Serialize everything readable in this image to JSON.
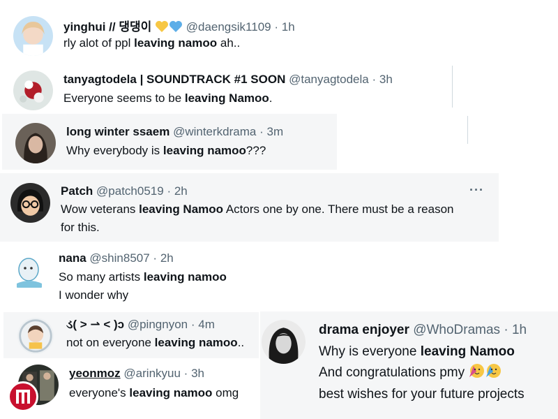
{
  "tweets": [
    {
      "name": "yinghui // 댕댕이",
      "name_emojis": [
        "yellow-heart-icon",
        "blue-heart-icon"
      ],
      "handle": "@daengsik1109",
      "time": "1h",
      "text_pre": "rly alot of ppl ",
      "text_bold": "leaving namoo",
      "text_post": " ah..",
      "colors": {
        "hair": "#e8c79a",
        "skin": "#f3d9c6",
        "bg": "#c7e2f5"
      }
    },
    {
      "name": "tanyagtodela | SOUNDTRACK #1 SOON",
      "handle": "@tanyagtodela",
      "time": "3h",
      "text_pre": "Everyone seems to be ",
      "text_bold": "leaving Namoo",
      "text_post": ".",
      "colors": {
        "flower": "#b21e2a",
        "bg": "#dfe6e4"
      }
    },
    {
      "name": "long winter ssaem",
      "handle": "@winterkdrama",
      "time": "3m",
      "text_pre": "Why everybody is ",
      "text_bold": "leaving namoo",
      "text_post": "???",
      "colors": {
        "hair": "#2a221d",
        "skin": "#d9b8a3",
        "bg": "#6a6158"
      }
    },
    {
      "name": "Patch",
      "handle": "@patch0519",
      "time": "2h",
      "text_pre": "Wow veterans ",
      "text_bold": "leaving Namoo",
      "text_post": " Actors one by one. There must be a reason",
      "text_line2": "for this.",
      "more": "···",
      "colors": {
        "hair": "#111111",
        "skin": "#f0c9a6",
        "bg": "#2b2b2b"
      }
    },
    {
      "name": "nana",
      "handle": "@shin8507",
      "time": "2h",
      "text_pre": "So many artists ",
      "text_bold": "leaving namoo",
      "text_post": "",
      "text_line2": "I wonder why",
      "colors": {
        "body": "#e8f1f6",
        "outline": "#5aa7c8",
        "bg": "#ffffff"
      }
    },
    {
      "name": "ડ( > ⇀ < )ɔ",
      "handle": "@pingnyon",
      "time": "4m",
      "text_pre": "not on everyone ",
      "text_bold": "leaving namoo",
      "text_post": "..",
      "colors": {
        "ring": "#b9c6cf",
        "skin": "#f2d4bd",
        "bg": "#eef1f3"
      }
    },
    {
      "name": "yeonmoz",
      "handle": "@arinkyuu",
      "time": "3h",
      "text_pre": "everyone's ",
      "text_bold": "leaving namoo",
      "text_post": " omg",
      "colors": {
        "a": "#3b3a35",
        "b": "#7a7a6a",
        "bg": "#2a2f2a"
      }
    },
    {
      "name": "drama enjoyer",
      "handle": "@WhoDramas",
      "time": "1h",
      "text_pre": "Why is everyone ",
      "text_bold": "leaving Namoo",
      "text_post": "",
      "text_line2": "And congratulations pmy",
      "text_line2_emojis": [
        "partying-face-icon",
        "partying-face-icon"
      ],
      "text_line3": "best wishes for your future projects",
      "colors": {
        "hair": "#1a1a1a",
        "skin": "#d8d8d8",
        "bg": "#eaeaea"
      }
    }
  ],
  "separator": "·",
  "watermark": {
    "icon": "logo-icon",
    "color": "#c8102e"
  }
}
